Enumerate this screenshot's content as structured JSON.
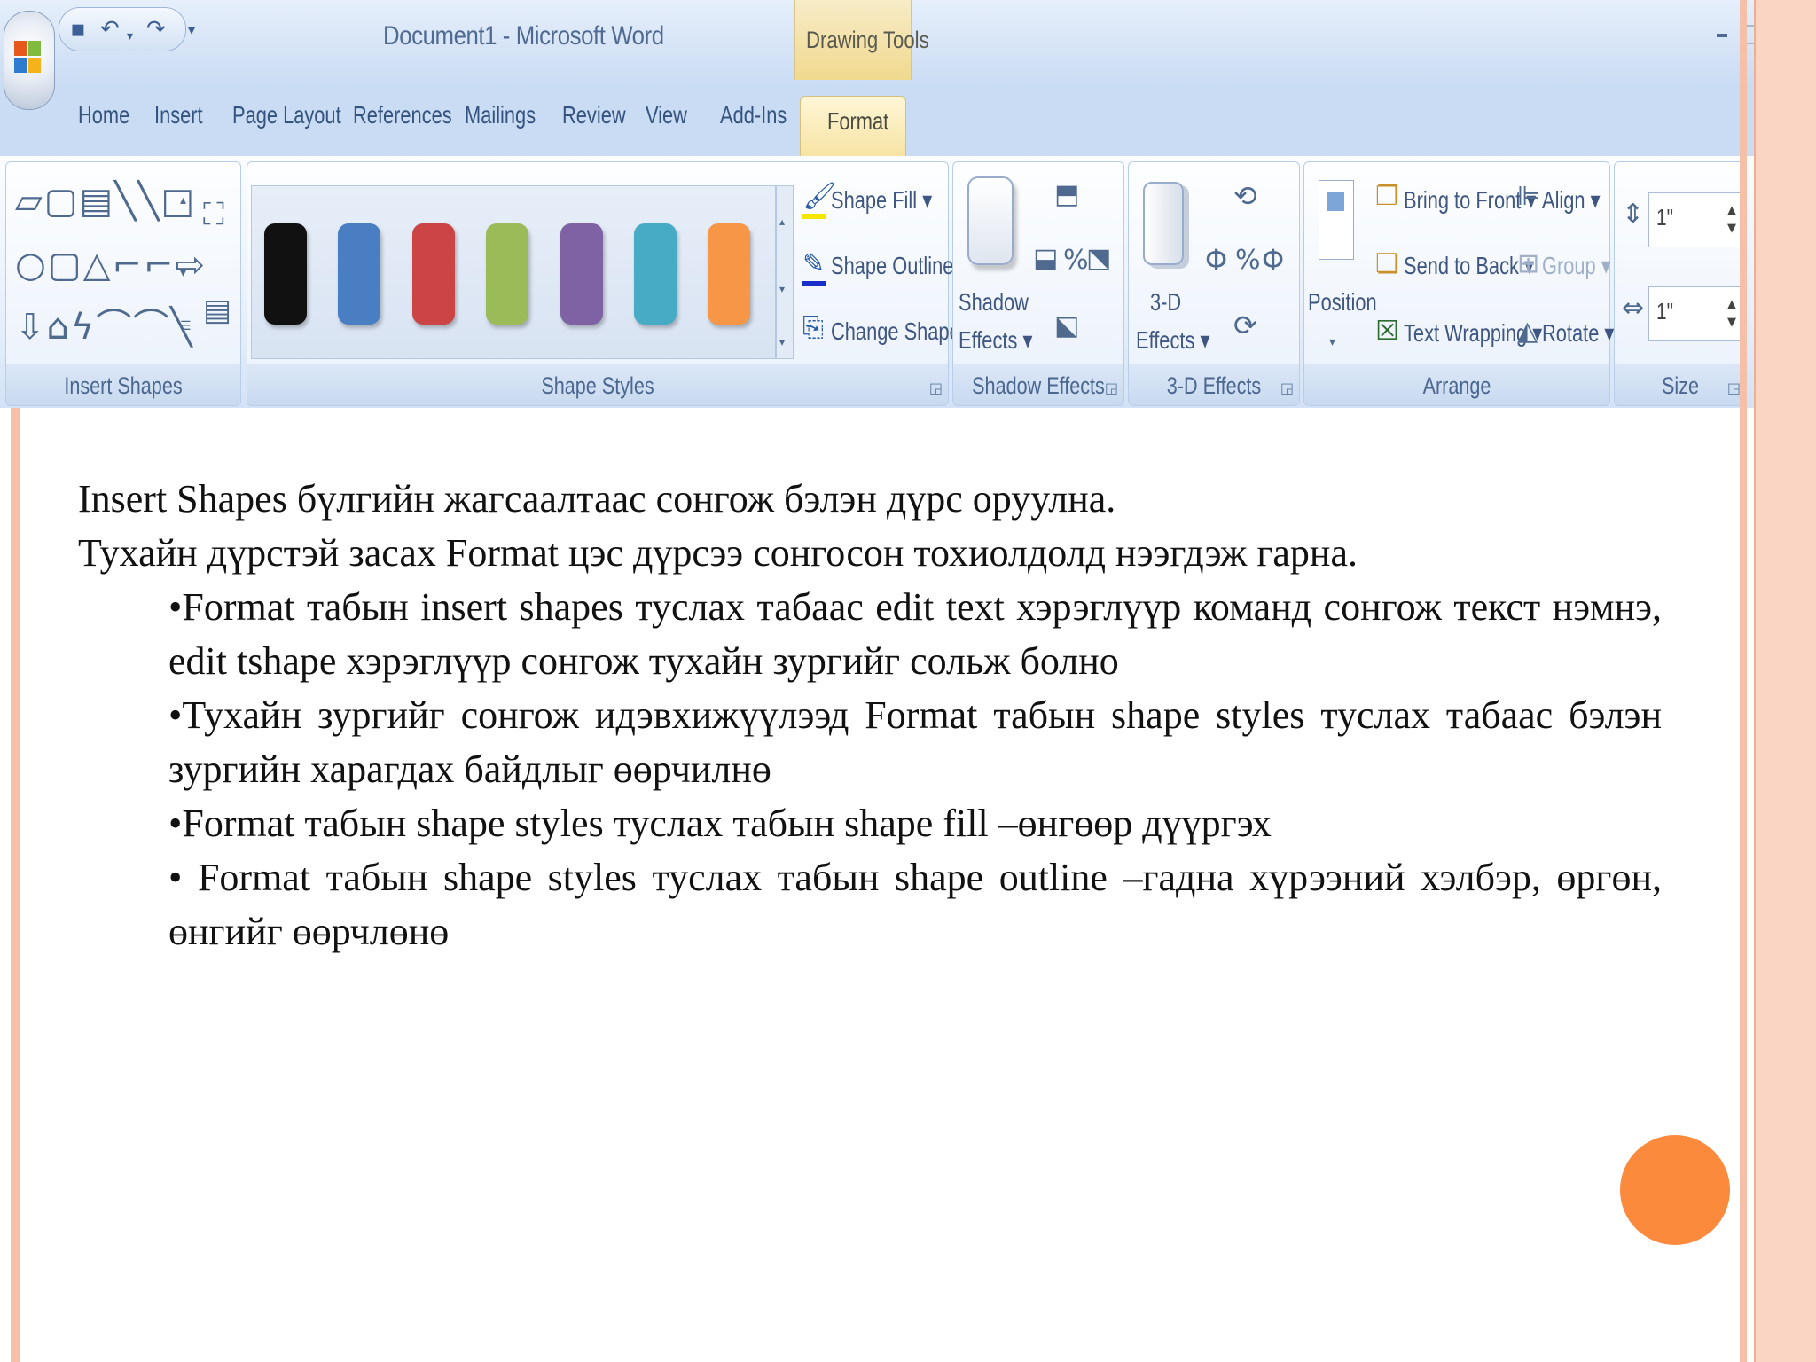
{
  "window": {
    "title": "Document1 - Microsoft Word",
    "contextual_tab_group": "Drawing Tools"
  },
  "tabs": [
    "Home",
    "Insert",
    "Page Layout",
    "References",
    "Mailings",
    "Review",
    "View",
    "Add-Ins"
  ],
  "active_tab": "Format",
  "ribbon": {
    "groups": {
      "insert_shapes": "Insert Shapes",
      "shape_styles": "Shape Styles",
      "shadow_effects": "Shadow Effects",
      "three_d_effects": "3-D Effects",
      "arrange": "Arrange",
      "size": "Size"
    },
    "shape_styles": {
      "swatch_colors": [
        "#111111",
        "#4a7ec3",
        "#cc4545",
        "#9bbb59",
        "#7f62a3",
        "#47abc6",
        "#f79646"
      ],
      "shape_fill": "Shape Fill",
      "shape_outline": "Shape Outline",
      "change_shape": "Change Shape"
    },
    "shadow": {
      "line1": "Shadow",
      "line2": "Effects"
    },
    "three_d": {
      "line1": "3-D",
      "line2": "Effects"
    },
    "arrange": {
      "position": "Position",
      "bring_to_front": "Bring to Front",
      "send_to_back": "Send to Back",
      "text_wrapping": "Text Wrapping",
      "align": "Align",
      "group": "Group",
      "rotate": "Rotate"
    },
    "size": {
      "height": "1\"",
      "width": "1\""
    }
  },
  "slide": {
    "lines": [
      "Insert Shapes бүлгийн жагсаалтаас сонгож бэлэн дүрс оруулна.",
      "Тухайн дүрстэй засах Format цэс дүрсээ сонгосон тохиолдолд нээгдэж гарна."
    ],
    "bullets": [
      "•Format табын insert shapes туслах табаас edit text хэрэглүүр команд сонгож текст нэмнэ, edit tshape хэрэглүүр сонгож тухайн зургийг сольж болно",
      "•Тухайн зургийг сонгож идэвхижүүлээд Format табын shape styles туслах табаас бэлэн зургийн харагдах байдлыг өөрчилнө",
      "•Format табын shape styles туслах табын shape fill –өнгөөр дүүргэх",
      "• Format табын shape styles туслах табын shape outline –гадна хүрээний хэлбэр, өргөн, өнгийг өөрчлөнө"
    ]
  },
  "colors": {
    "accent_orange": "#fb8a3c",
    "frame_salmon": "#f6c0a8",
    "ribbon_blue": "#c9dcf3"
  }
}
